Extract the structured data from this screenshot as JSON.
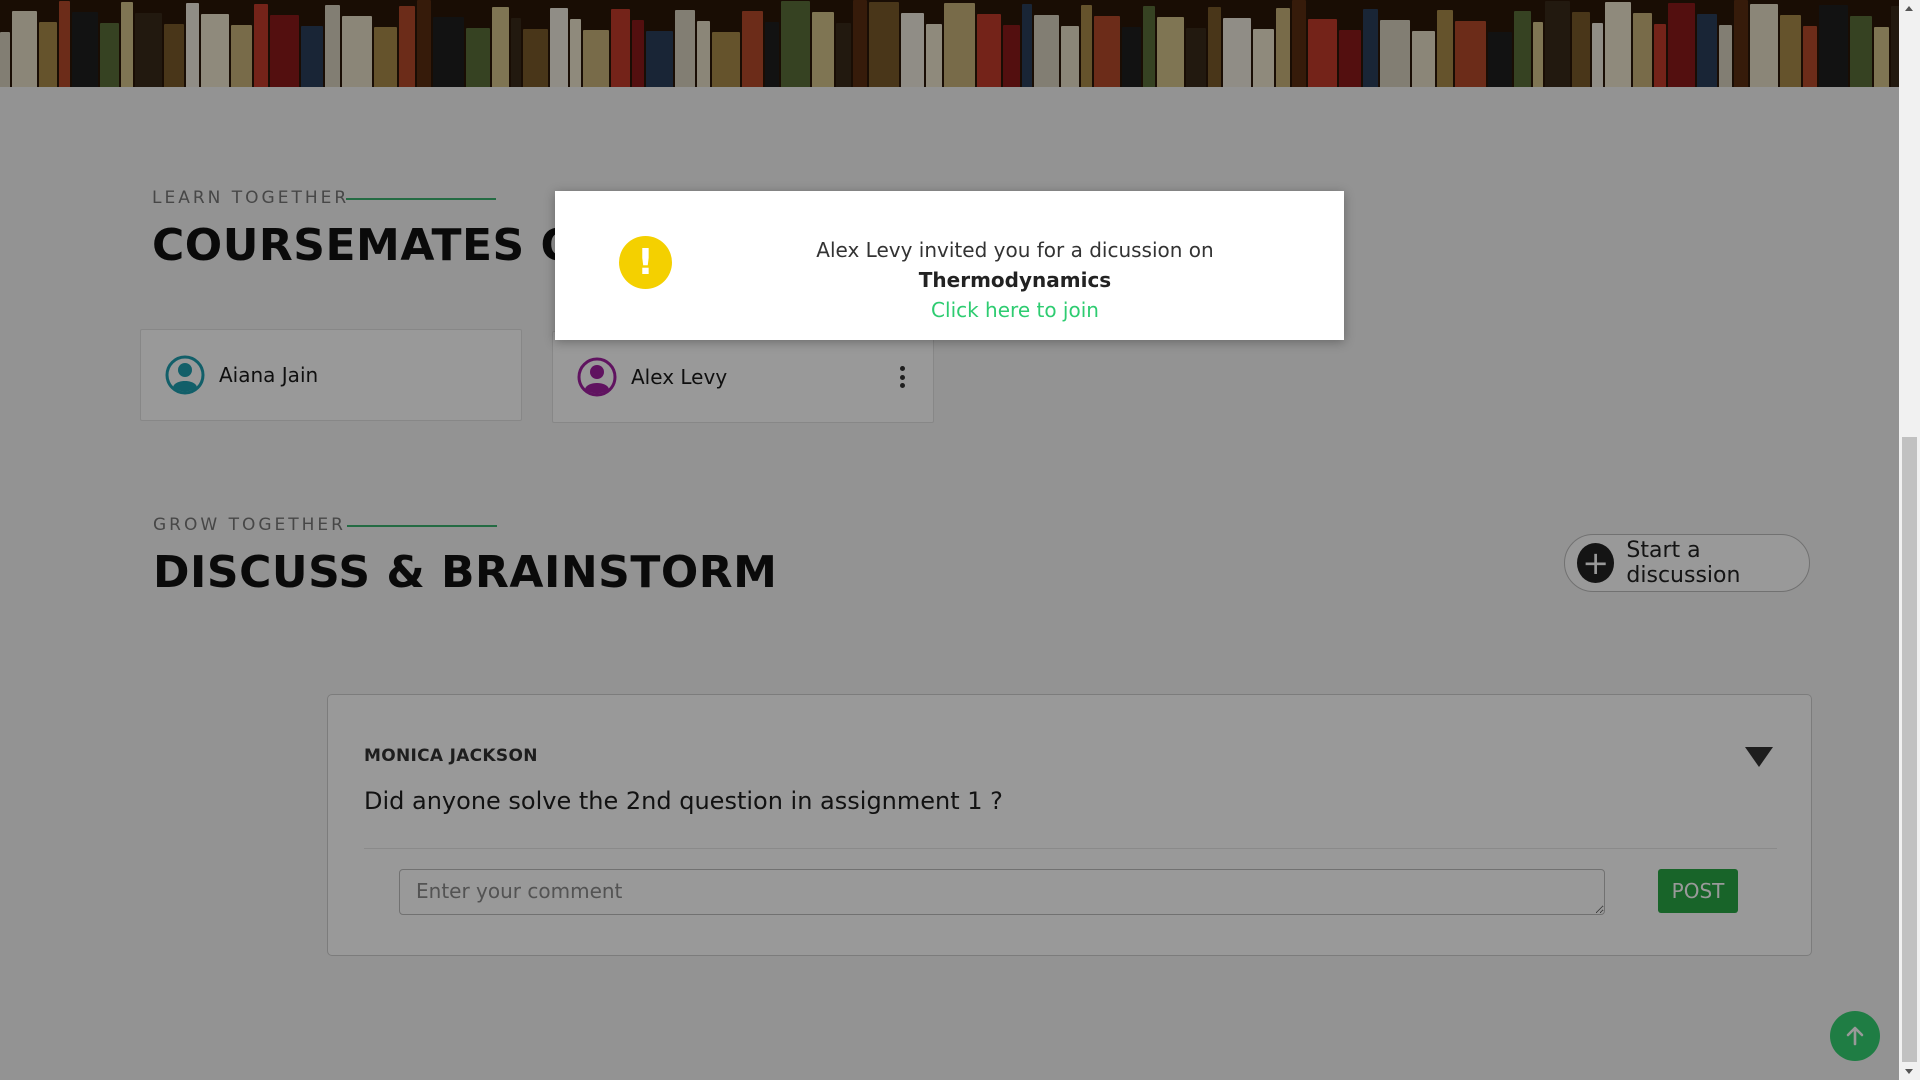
{
  "sections": {
    "learn": {
      "kicker": "LEARN TOGETHER",
      "title": "COURSEMATES ON"
    },
    "grow": {
      "kicker": "GROW TOGETHER",
      "title": "DISCUSS & BRAINSTORM"
    }
  },
  "coursemates": [
    {
      "name": "Aiana Jain",
      "avatar_color": "#1e9fb0"
    },
    {
      "name": "Alex Levy",
      "avatar_color": "#a020a0"
    }
  ],
  "start_discussion": {
    "label": "Start a discussion",
    "icon": "plus-icon"
  },
  "discussion": {
    "author": "MONICA JACKSON",
    "question": "Did anyone solve the 2nd question in assignment 1 ?",
    "comment_placeholder": "Enter your comment",
    "post_label": "POST"
  },
  "modal": {
    "icon": "exclamation-icon",
    "message_prefix": "Alex Levy invited you for a dicussion on",
    "topic": "Thermodynamics",
    "link_label": "Click here to join"
  },
  "colors": {
    "accent": "#28a745",
    "link": "#2ecc71",
    "warning": "#f4d000",
    "scroll_top": "#35d072"
  }
}
